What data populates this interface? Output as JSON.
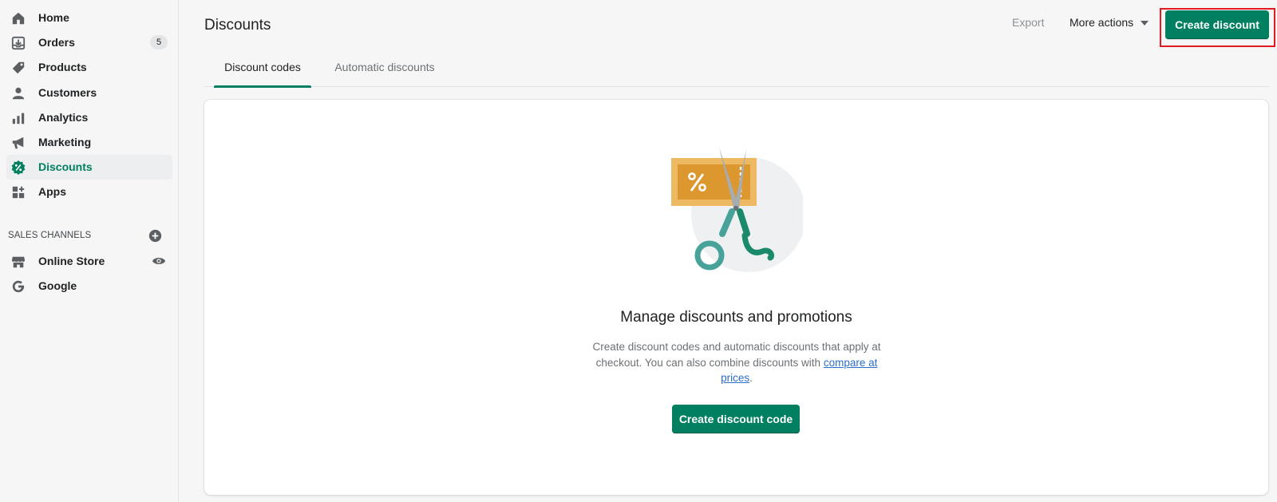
{
  "sidebar": {
    "items": [
      {
        "label": "Home",
        "icon": "home-icon"
      },
      {
        "label": "Orders",
        "icon": "orders-icon",
        "badge": "5"
      },
      {
        "label": "Products",
        "icon": "tag-icon"
      },
      {
        "label": "Customers",
        "icon": "person-icon"
      },
      {
        "label": "Analytics",
        "icon": "bar-chart-icon"
      },
      {
        "label": "Marketing",
        "icon": "megaphone-icon"
      },
      {
        "label": "Discounts",
        "icon": "discount-badge-icon",
        "active": true
      },
      {
        "label": "Apps",
        "icon": "apps-icon"
      }
    ],
    "sales_channels_label": "SALES CHANNELS",
    "channels": [
      {
        "label": "Online Store",
        "icon": "store-icon"
      },
      {
        "label": "Google",
        "icon": "google-icon"
      }
    ]
  },
  "header": {
    "title": "Discounts",
    "export_label": "Export",
    "more_actions_label": "More actions",
    "create_label": "Create discount"
  },
  "tabs": [
    {
      "label": "Discount codes",
      "active": true
    },
    {
      "label": "Automatic discounts",
      "active": false
    }
  ],
  "empty_state": {
    "title": "Manage discounts and promotions",
    "description_before": "Create discount codes and automatic discounts that apply at checkout. You can also combine discounts with ",
    "link_text": "compare at prices",
    "description_after": ".",
    "button_label": "Create discount code"
  },
  "colors": {
    "accent": "#008060",
    "highlight_border": "#e11b22",
    "link": "#2c6ecb"
  }
}
